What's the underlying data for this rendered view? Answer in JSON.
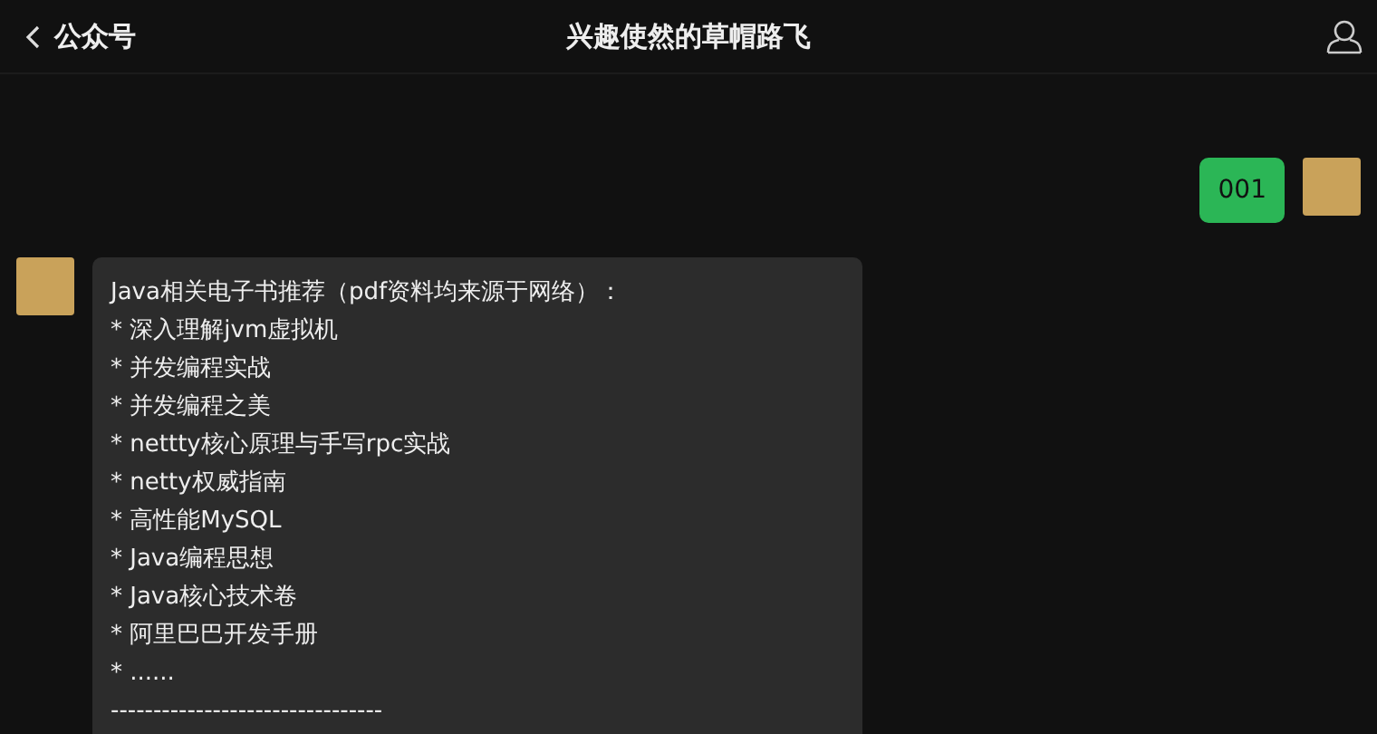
{
  "header": {
    "back_label": "公众号",
    "title": "兴趣使然的草帽路飞"
  },
  "messages": [
    {
      "kind": "sent",
      "lines": [
        "001"
      ]
    },
    {
      "kind": "received",
      "lines": [
        "Java相关电子书推荐（pdf资料均来源于网络）：",
        "* 深入理解jvm虚拟机",
        "* 并发编程实战",
        "* 并发编程之美",
        "* nettty核心原理与手写rpc实战",
        "* netty权威指南",
        "* 高性能MySQL",
        "* Java编程思想",
        "* Java核心技术卷",
        "* 阿里巴巴开发手册",
        "* ......",
        "--------------------------------"
      ]
    }
  ]
}
